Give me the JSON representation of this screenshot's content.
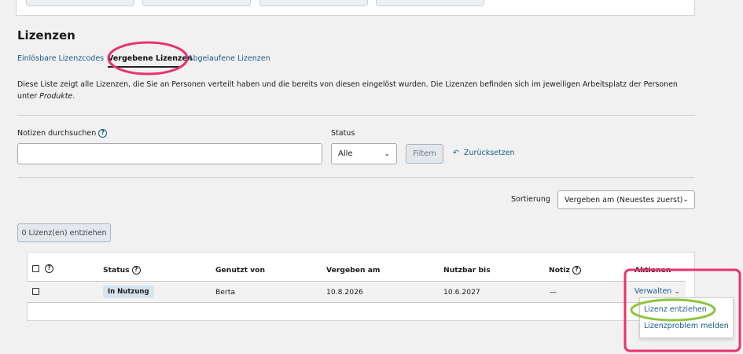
{
  "page": {
    "title": "Lizenzen",
    "description_main": "Diese Liste zeigt alle Lizenzen, die Sie an Personen verteilt haben und die bereits von diesen eingelöst wurden. Die Lizenzen befinden sich im jeweiligen Arbeitsplatz der Personen unter",
    "description_emphasis": "Produkte",
    "description_end": "."
  },
  "tabs": [
    {
      "label": "Einlösbare Lizenzcodes",
      "active": false
    },
    {
      "label": "Vergebene Lizenzen",
      "active": true
    },
    {
      "label": "Abgelaufene Lizenzen",
      "active": false
    }
  ],
  "filters": {
    "search_label": "Notizen durchsuchen",
    "search_value": "",
    "status_label": "Status",
    "status_value": "Alle",
    "filter_button": "Filtern",
    "reset_link": "Zurücksetzen"
  },
  "sorting": {
    "label": "Sortierung",
    "value": "Vergeben am (Neuestes zuerst)"
  },
  "bulk": {
    "revoke_button": "0 Lizenz(en) entziehen"
  },
  "table": {
    "columns": [
      "Status",
      "Genutzt von",
      "Vergeben am",
      "Nutzbar bis",
      "Notiz",
      "Aktionen"
    ],
    "rows": [
      {
        "status": "In Nutzung",
        "used_by": "Berta",
        "assigned_on": "10.8.2026",
        "usable_until": "10.6.2027",
        "note": "—",
        "action": "Verwalten"
      }
    ]
  },
  "actions_menu": {
    "items": [
      "Lizenz entziehen",
      "Lizenzproblem melden"
    ]
  },
  "colors": {
    "link": "#1a5a8a",
    "annotation_pink": "#e8336d",
    "annotation_green": "#8cc63f",
    "badge_bg": "#d6e4ef"
  },
  "icons": {
    "help": "?",
    "reset": "↶",
    "chevron": "⌄"
  }
}
